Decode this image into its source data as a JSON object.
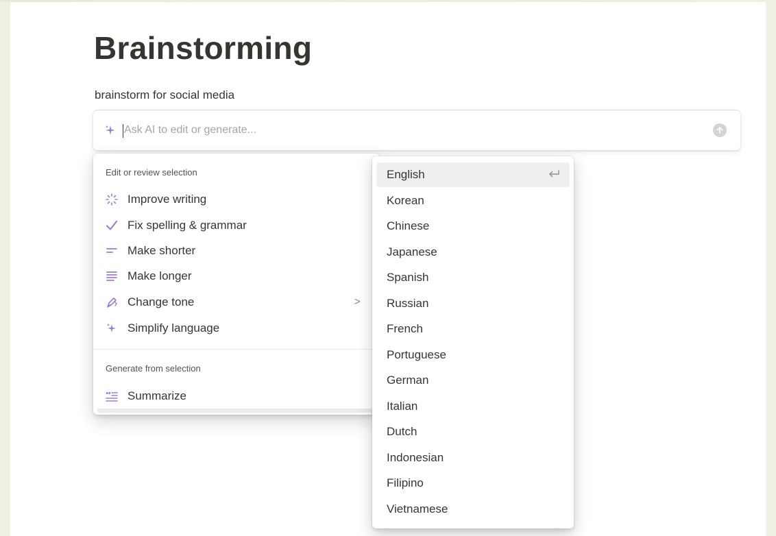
{
  "page": {
    "title": "Brainstorming",
    "subtitle": "brainstorm for social media"
  },
  "ai_bar": {
    "placeholder": "Ask AI to edit or generate...",
    "icon": "sparkle-icon",
    "send_icon": "arrow-up-circle-icon"
  },
  "edit_menu": {
    "section_label": "Edit or review selection",
    "items": [
      {
        "label": "Improve writing",
        "icon": "sparkle-burst-icon"
      },
      {
        "label": "Fix spelling & grammar",
        "icon": "check-icon"
      },
      {
        "label": "Make shorter",
        "icon": "short-lines-icon"
      },
      {
        "label": "Make longer",
        "icon": "long-lines-icon"
      },
      {
        "label": "Change tone",
        "icon": "pen-icon",
        "submenu": ">"
      },
      {
        "label": "Simplify language",
        "icon": "sparkle-icon"
      }
    ],
    "generate_label": "Generate from selection",
    "generate_items": [
      {
        "label": "Summarize",
        "icon": "quote-lines-icon"
      }
    ]
  },
  "language_menu": {
    "items": [
      "English",
      "Korean",
      "Chinese",
      "Japanese",
      "Spanish",
      "Russian",
      "French",
      "Portuguese",
      "German",
      "Italian",
      "Dutch",
      "Indonesian",
      "Filipino",
      "Vietnamese"
    ],
    "selected": "English",
    "selected_icon": "enter-key-icon"
  },
  "colors": {
    "accent": "#9b6bcc",
    "text": "#37352f",
    "muted": "#a6a5a1",
    "background": "#eef1e4"
  }
}
